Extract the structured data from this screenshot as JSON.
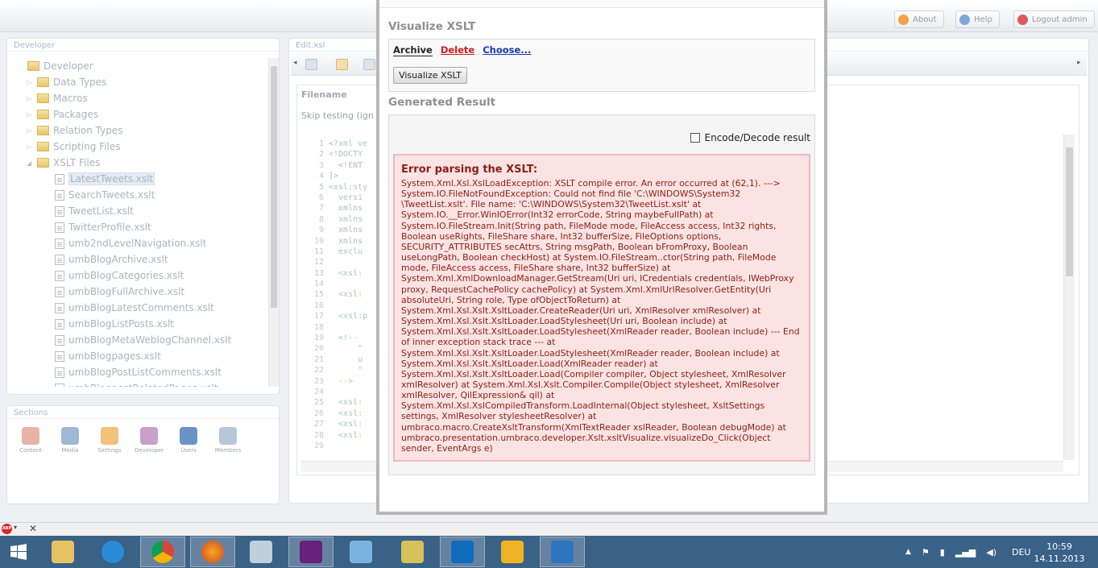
{
  "topbar": {
    "about_label": "About",
    "help_label": "Help",
    "logout_label": "Logout admin"
  },
  "developer_panel": {
    "title": "Developer",
    "root": "Developer",
    "folders": [
      "Data Types",
      "Macros",
      "Packages",
      "Relation Types",
      "Scripting Files",
      "XSLT Files"
    ],
    "files": [
      "LatestTweets.xslt",
      "SearchTweets.xslt",
      "TweetList.xslt",
      "TwitterProfile.xslt",
      "umb2ndLevelNavigation.xslt",
      "umbBlogArchive.xslt",
      "umbBlogCategories.xslt",
      "umbBlogFullArchive.xslt",
      "umbBlogLatestComments.xslt",
      "umbBlogListPosts.xslt",
      "umbBlogMetaWeblogChannel.xslt",
      "umbBlogpages.xslt",
      "umbBlogPostListComments.xslt",
      "umbBlogpostRelatedPages.xslt"
    ]
  },
  "sections_panel": {
    "title": "Sections",
    "items": [
      "Content",
      "Media",
      "Settings",
      "Developer",
      "Users",
      "Members"
    ]
  },
  "editor": {
    "tab_title": "Edit.xsl",
    "filename_label": "Filename",
    "skip_label": "Skip testing (ign",
    "line_numbers": [
      "1",
      "2",
      "3",
      "4",
      "5",
      "6",
      "7",
      "8",
      "9",
      "10",
      "11",
      "12",
      "13",
      "14",
      "15",
      "16",
      "17",
      "18",
      "19",
      "20",
      "21",
      "22",
      "23",
      "24",
      "25",
      "26",
      "27",
      "28",
      "29"
    ],
    "code_lines": [
      "<?xml ve",
      "<!DOCTY",
      "  <!ENT",
      "]>",
      "<xsl:sty",
      "  versi",
      "  xmlns",
      "  xmlns",
      "  xmlns",
      "  xmlns",
      "  exclu",
      "",
      "  <xsl:",
      "",
      "  <xsl:",
      "",
      "  <xsl:p",
      "",
      "  <!--",
      "      \"",
      "      u",
      "      \"",
      "  -->",
      "",
      "  <xsl:",
      "  <xsl:",
      "  <xsl:",
      "  <xsl:",
      ""
    ]
  },
  "modal": {
    "visualize_heading": "Visualize XSLT",
    "archive_link": "Archive",
    "delete_link": "Delete",
    "choose_link": "Choose...",
    "visualize_button": "Visualize XSLT",
    "result_heading": "Generated Result",
    "encode_label": "Encode/Decode result",
    "error_title": "Error parsing the XSLT:",
    "error_text": "System.Xml.Xsl.XslLoadException: XSLT compile error. An error occurred at (62,1). ---> System.IO.FileNotFoundException: Could not find file 'C:\\WINDOWS\\System32 \\TweetList.xslt'. File name: 'C:\\WINDOWS\\System32\\TweetList.xslt' at System.IO.__Error.WinIOError(Int32 errorCode, String maybeFullPath) at System.IO.FileStream.Init(String path, FileMode mode, FileAccess access, Int32 rights, Boolean useRights, FileShare share, Int32 bufferSize, FileOptions options, SECURITY_ATTRIBUTES secAttrs, String msgPath, Boolean bFromProxy, Boolean useLongPath, Boolean checkHost) at System.IO.FileStream..ctor(String path, FileMode mode, FileAccess access, FileShare share, Int32 bufferSize) at System.Xml.XmlDownloadManager.GetStream(Uri uri, ICredentials credentials, IWebProxy proxy, RequestCachePolicy cachePolicy) at System.Xml.XmlUrlResolver.GetEntity(Uri absoluteUri, String role, Type ofObjectToReturn) at System.Xml.Xsl.Xslt.XsltLoader.CreateReader(Uri uri, XmlResolver xmlResolver) at System.Xml.Xsl.Xslt.XsltLoader.LoadStylesheet(Uri uri, Boolean include) at System.Xml.Xsl.Xslt.XsltLoader.LoadStylesheet(XmlReader reader, Boolean include) --- End of inner exception stack trace --- at System.Xml.Xsl.Xslt.XsltLoader.LoadStylesheet(XmlReader reader, Boolean include) at System.Xml.Xsl.Xslt.XsltLoader.Load(XmlReader reader) at System.Xml.Xsl.Xslt.XsltLoader.Load(Compiler compiler, Object stylesheet, XmlResolver xmlResolver) at System.Xml.Xsl.Xslt.Compiler.Compile(Object stylesheet, XmlResolver xmlResolver, QilExpression& qil) at System.Xml.Xsl.XslCompiledTransform.LoadInternal(Object stylesheet, XsltSettings settings, XmlResolver stylesheetResolver) at umbraco.macro.CreateXsltTransform(XmlTextReader xslReader, Boolean debugMode) at umbraco.presentation.umbraco.developer.Xslt.xsltVisualize.visualizeDo_Click(Object sender, EventArgs e)"
  },
  "taskbar": {
    "language": "DEU",
    "time": "10:59",
    "date": "14.11.2013"
  },
  "abp": {
    "badge": "ABP",
    "caret": "▾",
    "close": "✕"
  },
  "colors": {
    "error_bg": "#fbe3e4",
    "error_border": "#f2b7ba",
    "error_text": "#8a1f11",
    "taskbar": "#3a6186"
  }
}
